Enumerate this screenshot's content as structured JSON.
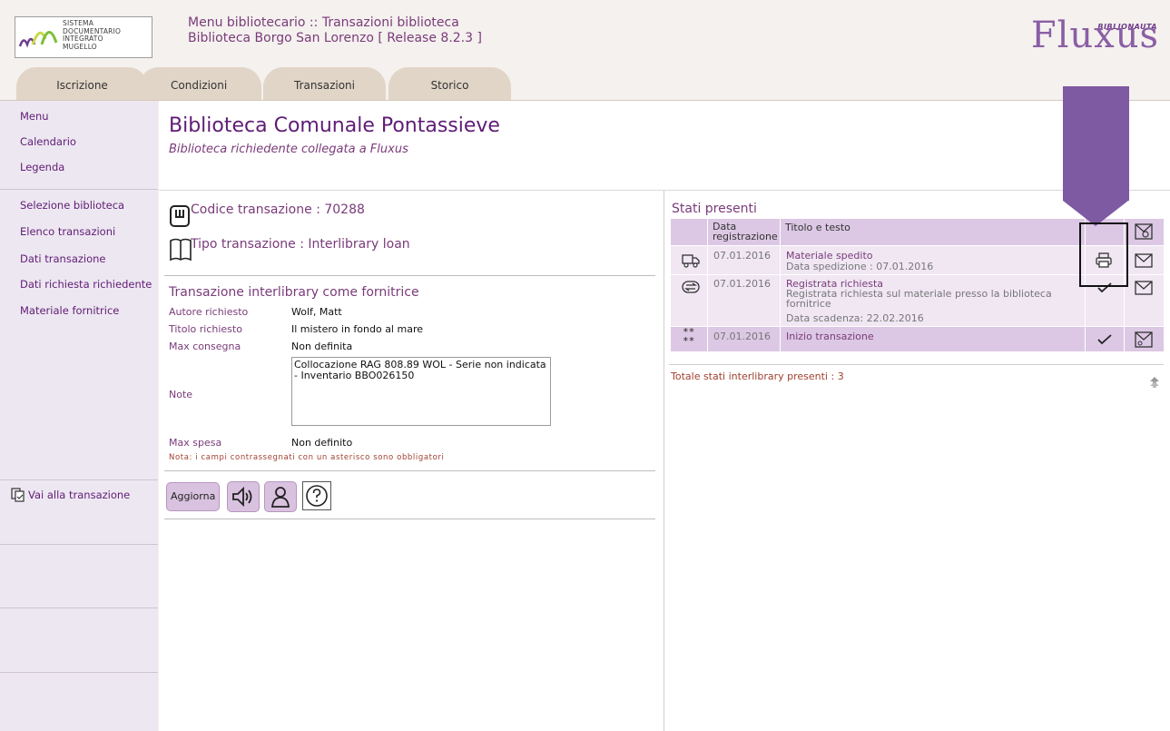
{
  "header": {
    "logo_lines": [
      "Sistema",
      "Documentario",
      "Integrato",
      "Mugello"
    ],
    "title": "Menu bibliotecario :: Transazioni biblioteca",
    "subtitle": "Biblioteca Borgo San Lorenzo [ Release 8.2.3 ]",
    "brand": "Fluxus",
    "brand_small": "BIBLIONAUTA"
  },
  "tabs": [
    {
      "label": "Iscrizione"
    },
    {
      "label": "Condizioni"
    },
    {
      "label": "Transazioni"
    },
    {
      "label": "Storico"
    }
  ],
  "sidebar": {
    "group1": [
      {
        "label": "Menu"
      },
      {
        "label": "Calendario"
      },
      {
        "label": "Legenda"
      }
    ],
    "group2": [
      {
        "label": "Selezione biblioteca"
      },
      {
        "label": "Elenco transazioni"
      },
      {
        "label": "Dati transazione"
      },
      {
        "label": "Dati richiesta richiedente"
      },
      {
        "label": "Materiale fornitrice"
      }
    ],
    "goto_label": "Vai alla transazione"
  },
  "library": {
    "title": "Biblioteca Comunale Pontassieve",
    "subtitle": "Biblioteca richiedente collegata a Fluxus"
  },
  "transaction": {
    "code": "Codice transazione : 70288",
    "type": "Tipo transazione : Interlibrary loan",
    "section_title": "Transazione interlibrary come fornitrice",
    "fields": [
      {
        "label": "Autore richiesto",
        "value": "Wolf, Matt"
      },
      {
        "label": "Titolo richiesto",
        "value": "Il mistero in fondo al mare"
      },
      {
        "label": "Max consegna",
        "value": "Non definita"
      }
    ],
    "note_label": "Note",
    "note_text": "Collocazione RAG 808.89 WOL - Serie non indicata - Inventario BBO026150",
    "max_spesa_label": "Max spesa",
    "max_spesa_value": "Non definito",
    "required_note": "Nota: i campi contrassegnati con un asterisco sono obbligatori",
    "update_button": "Aggiorna"
  },
  "states": {
    "title": "Stati presenti",
    "col_date": "Data registrazione",
    "col_title": "Titolo e testo",
    "rows": [
      {
        "icon": "truck-icon",
        "date": "07.01.2016",
        "title": "Materiale spedito",
        "text": "Data spedizione : 07.01.2016",
        "status_icon": "print-icon"
      },
      {
        "icon": "exchange-icon",
        "date": "07.01.2016",
        "title": "Registrata richiesta",
        "text": "Registrata richiesta sul materiale presso la biblioteca fornitrice",
        "text2": "Data scadenza: 22.02.2016",
        "status_icon": "check-icon"
      },
      {
        "icon": "asterisks-icon",
        "date": "07.01.2016",
        "title": "Inizio transazione",
        "text": "",
        "status_icon": "check-icon"
      }
    ],
    "total": "Totale stati interlibrary presenti : 3"
  },
  "colors": {
    "accent": "#7a3b7a",
    "tab": "#e1d5c7",
    "sidebar": "#ede7f1",
    "row_light": "#f0e7f3",
    "row_dark": "#dcc8e4",
    "arrow": "#7d5aa2"
  }
}
